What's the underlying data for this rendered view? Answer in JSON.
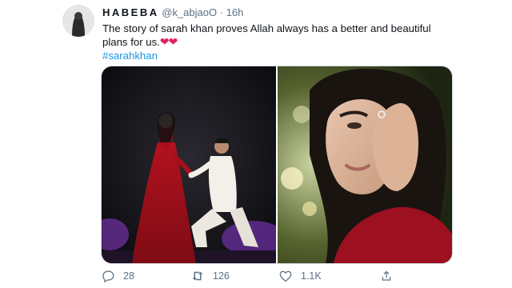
{
  "tweet": {
    "author_name": "HABEBA",
    "author_handle": "@k_abjaoO",
    "separator": "·",
    "time": "16h",
    "text": "The story of sarah khan proves Allah always has a better and beautiful plans for us.",
    "hearts": "❤❤",
    "hashtag": "#sarahkhan"
  },
  "media": [
    {
      "icon": "proposal-photo"
    },
    {
      "icon": "portrait-photo"
    }
  ],
  "actions": {
    "reply_icon": "reply-icon",
    "reply_count": "28",
    "retweet_icon": "retweet-icon",
    "retweet_count": "126",
    "like_icon": "like-icon",
    "like_count": "1.1K",
    "share_icon": "share-icon"
  },
  "colors": {
    "link": "#1b95e0",
    "secondary_text": "#5b7083",
    "heart": "#e0245e"
  }
}
